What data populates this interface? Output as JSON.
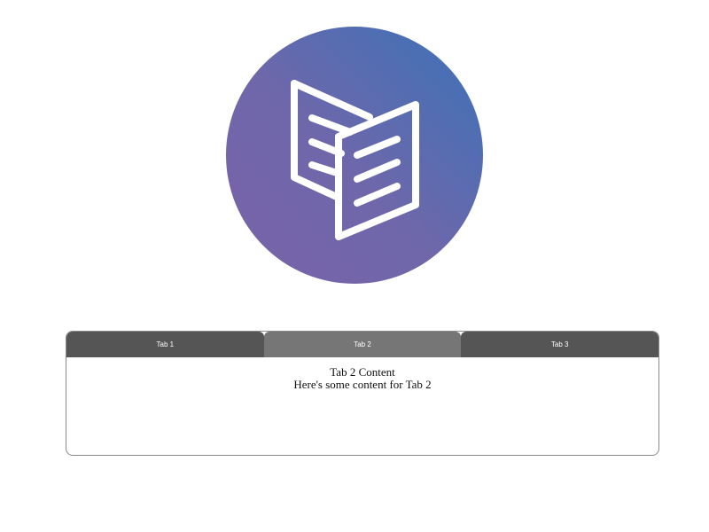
{
  "logo": {
    "icon": "open-book-icon",
    "gradient_start": "#7a62a8",
    "gradient_end": "#3b72b8",
    "foreground": "#ffffff"
  },
  "tabs": {
    "items": [
      {
        "label": "Tab 1"
      },
      {
        "label": "Tab 2"
      },
      {
        "label": "Tab 3"
      }
    ],
    "active_index": 1,
    "colors": {
      "inactive": "#555555",
      "active": "#767676",
      "border": "#8a8a8a"
    },
    "panel": {
      "title": "Tab 2 Content",
      "body": "Here's some content for Tab 2"
    }
  }
}
